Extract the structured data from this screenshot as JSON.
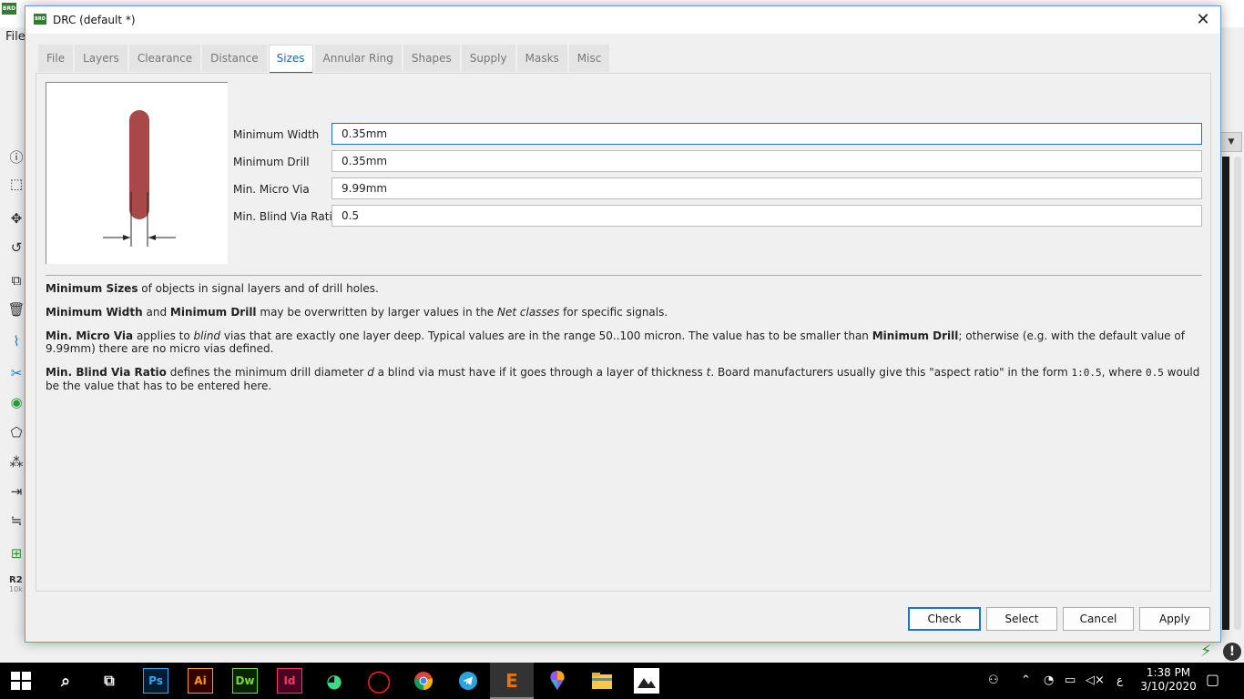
{
  "background_app": {
    "menu_file": "File",
    "part_ref": "R2",
    "part_value": "10k",
    "dropdown_arrow": "▼"
  },
  "dialog": {
    "title": "DRC (default *)",
    "tabs": [
      "File",
      "Layers",
      "Clearance",
      "Distance",
      "Sizes",
      "Annular Ring",
      "Shapes",
      "Supply",
      "Masks",
      "Misc"
    ],
    "active_tab": "Sizes",
    "fields": [
      {
        "label": "Minimum Width",
        "value": "0.35mm"
      },
      {
        "label": "Minimum Drill",
        "value": "0.35mm"
      },
      {
        "label": "Min. Micro Via",
        "value": "9.99mm"
      },
      {
        "label": "Min. Blind Via Ratio",
        "value": "0.5"
      }
    ],
    "help": {
      "p1_b1": "Minimum Sizes",
      "p1_t1": " of objects in signal layers and of drill holes.",
      "p2_b1": "Minimum Width",
      "p2_t1": " and ",
      "p2_b2": "Minimum Drill",
      "p2_t2": " may be overwritten by larger values in the ",
      "p2_i1": "Net classes",
      "p2_t3": " for specific signals.",
      "p3_b1": "Min. Micro Via",
      "p3_t1": " applies to ",
      "p3_i1": "blind",
      "p3_t2": " vias that are exactly one layer deep. Typical values are in the range 50..100 micron. The value has to be smaller than ",
      "p3_b2": "Minimum Drill",
      "p3_t3": "; otherwise (e.g. with the default value of 9.99mm) there are no micro vias defined.",
      "p4_b1": "Min. Blind Via Ratio",
      "p4_t1": " defines the minimum drill diameter ",
      "p4_i1": "d",
      "p4_t2": " a blind via must have if it goes through a layer of thickness ",
      "p4_i2": "t",
      "p4_t3": ". Board manufacturers usually give this \"aspect ratio\" in the form ",
      "p4_m1": "1:0.5",
      "p4_t4": ", where ",
      "p4_m2": "0.5",
      "p4_t5": " would be the value that has to be entered here."
    },
    "buttons": {
      "check": "Check",
      "select": "Select",
      "cancel": "Cancel",
      "apply": "Apply"
    },
    "close_glyph": "✕"
  },
  "preview_colors": {
    "trace": "#a84848"
  },
  "taskbar": {
    "apps": [
      "Ps",
      "Ai",
      "Dw",
      "Id",
      "E"
    ],
    "time": "1:38 PM",
    "date": "3/10/2020",
    "lang": "ع"
  }
}
